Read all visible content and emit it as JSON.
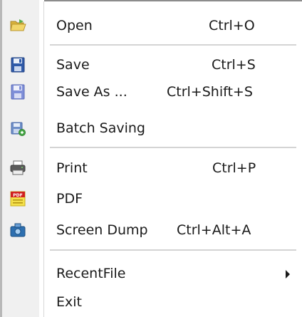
{
  "menu": {
    "items": [
      {
        "label": "Open",
        "shortcut": "Ctrl+O",
        "icon": "open-folder-icon"
      },
      {
        "label": "Save",
        "shortcut": "Ctrl+S",
        "icon": "save-disk-icon"
      },
      {
        "label": "Save As ...",
        "shortcut": "Ctrl+Shift+S",
        "icon": "save-as-disk-icon"
      },
      {
        "label": "Batch Saving",
        "shortcut": "",
        "icon": "batch-save-icon"
      },
      {
        "label": "Print",
        "shortcut": "Ctrl+P",
        "icon": "printer-icon"
      },
      {
        "label": "PDF",
        "shortcut": "",
        "icon": "pdf-icon"
      },
      {
        "label": "Screen Dump",
        "shortcut": "Ctrl+Alt+A",
        "icon": "screen-dump-icon"
      },
      {
        "label": "RecentFile",
        "shortcut": "",
        "icon": "submenu-arrow-icon"
      },
      {
        "label": "Exit",
        "shortcut": "",
        "icon": ""
      }
    ]
  },
  "colors": {
    "gutter": "#f0f0f0",
    "separator": "#d4d4d4",
    "text": "#1a1a1a",
    "folder": "#e8c94a",
    "disk": "#3a66b8",
    "printer": "#5a5a5a",
    "pdf": "#d02020"
  }
}
